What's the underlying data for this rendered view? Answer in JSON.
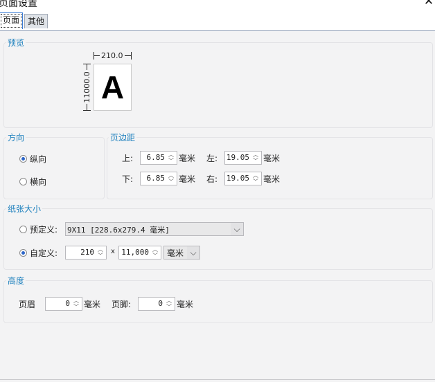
{
  "window": {
    "title": "页面设置",
    "close_glyph": "✕"
  },
  "tabs": [
    {
      "label": "页面",
      "active": true
    },
    {
      "label": "其他",
      "active": false
    }
  ],
  "preview": {
    "legend": "预览",
    "width_label": "210.0",
    "height_label": "11000.0",
    "letter": "A"
  },
  "orientation": {
    "legend": "方向",
    "options": [
      {
        "label": "纵向",
        "checked": true
      },
      {
        "label": "横向",
        "checked": false
      }
    ]
  },
  "margins": {
    "legend": "页边距",
    "top": {
      "label": "上:",
      "value": "6.85",
      "unit": "毫米"
    },
    "left": {
      "label": "左:",
      "value": "19.05",
      "unit": "毫米"
    },
    "bottom": {
      "label": "下:",
      "value": "6.85",
      "unit": "毫米"
    },
    "right": {
      "label": "右:",
      "value": "19.05",
      "unit": "毫米"
    }
  },
  "paper_size": {
    "legend": "纸张大小",
    "predefined": {
      "label": "预定义:",
      "checked": false,
      "value": "9X11 [228.6x279.4 毫米]"
    },
    "custom": {
      "label": "自定义:",
      "checked": true,
      "width": "210",
      "times": "x",
      "height": "11,000",
      "unit": "毫米"
    }
  },
  "height_section": {
    "legend": "高度",
    "header": {
      "label": "页眉",
      "value": "0",
      "unit": "毫米"
    },
    "footer": {
      "label": "页脚:",
      "value": "0",
      "unit": "毫米"
    }
  },
  "icons": {
    "spin_up": "︿",
    "spin_down": "﹀",
    "dropdown": "⌵"
  },
  "colors": {
    "legend": "#1b7fbd",
    "radio_checked": "#2c65c8",
    "tab_border_active": "#3a7bd5"
  }
}
